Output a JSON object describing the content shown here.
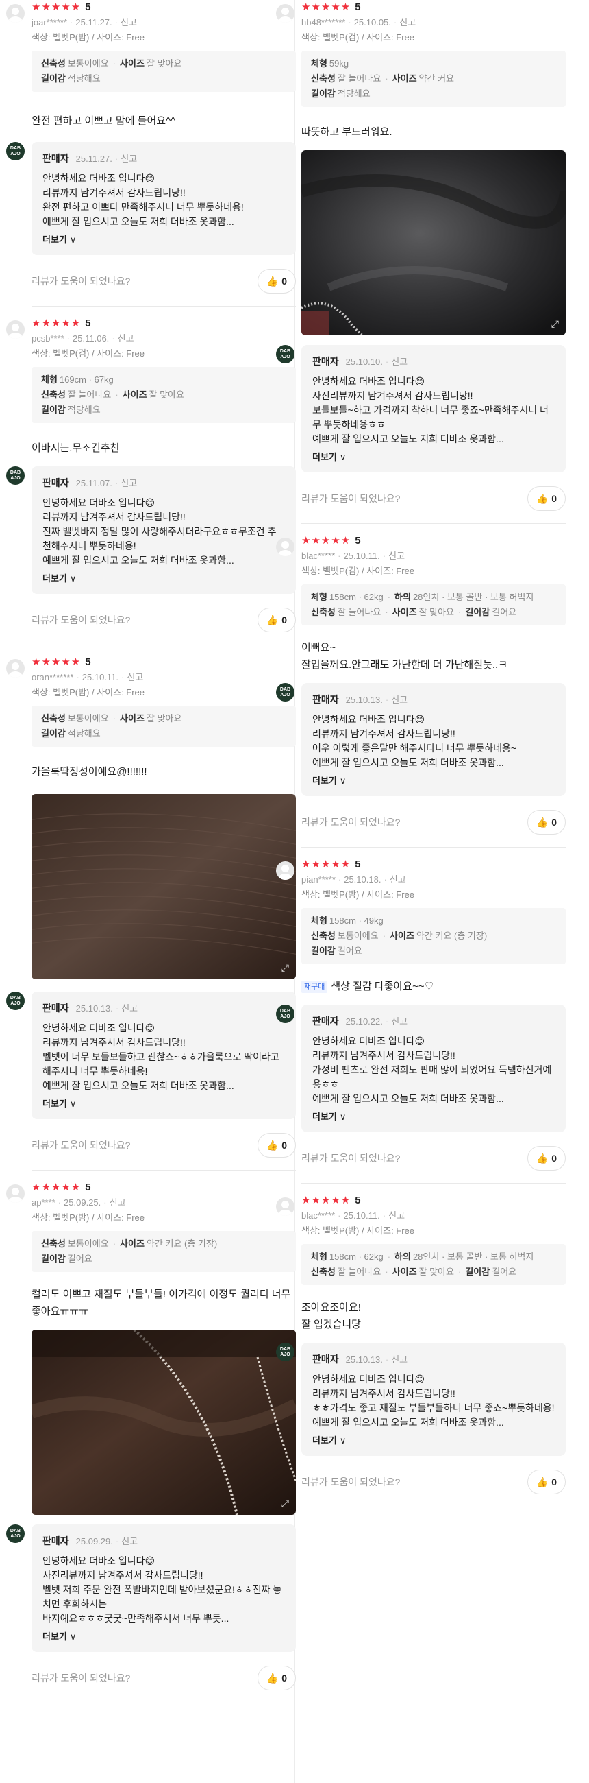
{
  "common": {
    "stars": "★★★★★",
    "report": "신고",
    "seller": "판매자",
    "more": "더보기",
    "chevron": "∨",
    "helpful": "리뷰가 도움이 되었나요?",
    "like_icon": "thumbs-up-icon",
    "brand_color": "#f0303c",
    "logo_text": "DAB AJO"
  },
  "reviews": [
    {
      "score": "5",
      "user": "joar******",
      "date": "25.11.27.",
      "option": "색상: 벨벳P(밤) / 사이즈: Free",
      "specs": [
        [
          {
            "k": "신축성",
            "v": "보통이에요"
          },
          {
            "k": "사이즈",
            "v": "잘 맞아요"
          }
        ],
        [
          {
            "k": "길이감",
            "v": "적당해요"
          }
        ]
      ],
      "text": "완전 편하고 이쁘고 맘에 들어요^^",
      "seller_date": "25.11.27.",
      "seller_text": "안녕하세요 더바조 입니다😊\n리뷰까지 남겨주셔서 감사드립니당!!\n완전 편하고 이쁘다 만족해주시니 너무 뿌듯하네용!\n예쁘게 잘 입으시고 오늘도 저희 더바조 옷과함...",
      "likes": "0"
    },
    {
      "score": "5",
      "user": "pcsb****",
      "date": "25.11.06.",
      "option": "색상: 벨벳P(검) / 사이즈: Free",
      "specs": [
        [
          {
            "k": "체형",
            "v": "169cm · 67kg"
          }
        ],
        [
          {
            "k": "신축성",
            "v": "잘 늘어나요"
          },
          {
            "k": "사이즈",
            "v": "잘 맞아요"
          }
        ],
        [
          {
            "k": "길이감",
            "v": "적당해요"
          }
        ]
      ],
      "text": "이바지는.무조건추천",
      "seller_date": "25.11.07.",
      "seller_text": "안녕하세요 더바조 입니다😊\n리뷰까지 남겨주셔서 감사드립니당!!\n진짜 벨벳바지 정말 많이 사랑해주시더라구요ㅎㅎ무조건 추천해주시니 뿌듯하네용!\n예쁘게 잘 입으시고 오늘도 저희 더바조 옷과함...",
      "likes": "0"
    },
    {
      "score": "5",
      "user": "oran*******",
      "date": "25.10.11.",
      "option": "색상: 벨벳P(밤) / 사이즈: Free",
      "specs": [
        [
          {
            "k": "신축성",
            "v": "보통이에요"
          },
          {
            "k": "사이즈",
            "v": "잘 맞아요"
          }
        ],
        [
          {
            "k": "길이감",
            "v": "적당해요"
          }
        ]
      ],
      "text": "가을룩딱정성이예요@!!!!!!!",
      "photo": "dark-brown-velvet-fabric",
      "seller_date": "25.10.13.",
      "seller_text": "안녕하세요 더바조 입니다😊\n리뷰까지 남겨주셔서 감사드립니당!!\n벨벳이 너무 보들보들하고 괜찮죠~ㅎㅎ가을룩으로 딱이라고 해주시니 너무 뿌듯하네용!\n예쁘게 잘 입으시고 오늘도 저희 더바조 옷과함...",
      "likes": "0"
    },
    {
      "score": "5",
      "user": "ap****",
      "date": "25.09.25.",
      "option": "색상: 벨벳P(밤) / 사이즈: Free",
      "specs": [
        [
          {
            "k": "신축성",
            "v": "보통이에요"
          },
          {
            "k": "사이즈",
            "v": "약간 커요 (총 기장)"
          }
        ],
        [
          {
            "k": "길이감",
            "v": "길어요"
          }
        ]
      ],
      "text": "컬러도 이쁘고 재질도 부들부들! 이가격에 이정도 퀄리티 너무좋아요ㅠㅠㅠ",
      "photo": "brown-velvet-with-lace-trim",
      "seller_date": "25.09.29.",
      "seller_text": "안녕하세요 더바조 입니다😊\n사진리뷰까지 남겨주셔서 감사드립니당!!\n벨벳 저희 주문 완전 폭발바지인데 받아보셨군요!ㅎㅎ진짜 놓치면 후회하시는\n바지예요ㅎㅎㅎ굿굿~만족해주셔서 너무 뿌듯...",
      "likes": "0"
    },
    {
      "score": "5",
      "user": "hb48*******",
      "date": "25.10.05.",
      "option": "색상: 벨벳P(검) / 사이즈: Free",
      "specs": [
        [
          {
            "k": "체형",
            "v": "59kg"
          }
        ],
        [
          {
            "k": "신축성",
            "v": "잘 늘어나요"
          },
          {
            "k": "사이즈",
            "v": "약간 커요"
          }
        ],
        [
          {
            "k": "길이감",
            "v": "적당해요"
          }
        ]
      ],
      "text": "따뜻하고 부드러워요.",
      "photo": "black-velvet-with-lace-trim",
      "seller_date": "25.10.10.",
      "seller_text": "안녕하세요 더바조 입니다😊\n사진리뷰까지 남겨주셔서 감사드립니당!!\n보들보들~하고 가격까지 착하니 너무 좋죠~만족해주시니 너무 뿌듯하네용ㅎㅎ\n예쁘게 잘 입으시고 오늘도 저희 더바조 옷과함...",
      "likes": "0"
    },
    {
      "score": "5",
      "user": "blac*****",
      "date": "25.10.11.",
      "option": "색상: 벨벳P(검) / 사이즈: Free",
      "specs": [
        [
          {
            "k": "체형",
            "v": "158cm · 62kg"
          },
          {
            "k": "하의",
            "v": "28인치 · 보통 골반 · 보통 허벅지"
          }
        ],
        [
          {
            "k": "신축성",
            "v": "잘 늘어나요"
          },
          {
            "k": "사이즈",
            "v": "잘 맞아요"
          },
          {
            "k": "길이감",
            "v": "길어요"
          }
        ]
      ],
      "text": "이뻐요~\n잘입을께요.안그래도 가난한데 더 가난해질듯..ㅋ",
      "seller_date": "25.10.13.",
      "seller_text": "안녕하세요 더바조 입니다😊\n리뷰까지 남겨주셔서 감사드립니당!!\n어우 이렇게 좋은말만 해주시다니 너무 뿌듯하네용~\n예쁘게 잘 입으시고 오늘도 저희 더바조 옷과함...",
      "likes": "0"
    },
    {
      "score": "5",
      "user": "pian*****",
      "date": "25.10.18.",
      "option": "색상: 벨벳P(밤) / 사이즈: Free",
      "specs": [
        [
          {
            "k": "체형",
            "v": "158cm · 49kg"
          }
        ],
        [
          {
            "k": "신축성",
            "v": "보통이에요"
          },
          {
            "k": "사이즈",
            "v": "약간 커요 (총 기장)"
          }
        ],
        [
          {
            "k": "길이감",
            "v": "길어요"
          }
        ]
      ],
      "rebuy": "재구매",
      "text": "색상 질감 다좋아요~~♡",
      "seller_date": "25.10.22.",
      "seller_text": "안녕하세요 더바조 입니다😊\n리뷰까지 남겨주셔서 감사드립니당!!\n가성비 팬츠로 완전 저희도 판매 많이 되었어요 득템하신거예용ㅎㅎ\n예쁘게 잘 입으시고 오늘도 저희 더바조 옷과함...",
      "likes": "0"
    },
    {
      "score": "5",
      "user": "blac*****",
      "date": "25.10.11.",
      "option": "색상: 벨벳P(밤) / 사이즈: Free",
      "specs": [
        [
          {
            "k": "체형",
            "v": "158cm · 62kg"
          },
          {
            "k": "하의",
            "v": "28인치 · 보통 골반 · 보통 허벅지"
          }
        ],
        [
          {
            "k": "신축성",
            "v": "잘 늘어나요"
          },
          {
            "k": "사이즈",
            "v": "잘 맞아요"
          },
          {
            "k": "길이감",
            "v": "길어요"
          }
        ]
      ],
      "text": "조아요조아요!\n잘 입겠습니당",
      "seller_date": "25.10.13.",
      "seller_text": "안녕하세요 더바조 입니다😊\n리뷰까지 남겨주셔서 감사드립니당!!\nㅎㅎ가격도 좋고 재질도 부들부들하니 너무 좋죠~뿌듯하네용!\n예쁘게 잘 입으시고 오늘도 저희 더바조 옷과함...",
      "likes": "0"
    }
  ]
}
